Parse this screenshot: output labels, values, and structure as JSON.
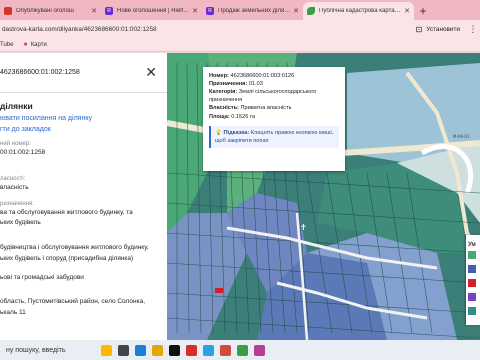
{
  "browser": {
    "tabs": [
      {
        "title": "Опублікувані оголош",
        "icon": "red"
      },
      {
        "title": "Нове оголошення | Rieltor від",
        "icon": "purple"
      },
      {
        "title": "Продаж земельних ділянок",
        "icon": "purple"
      },
      {
        "title": "Публічна кадастрова карта Ук",
        "icon": "leaf"
      }
    ],
    "new_tab_label": "+",
    "url": "dastrova-karta.com/dilyanka/4623686600:01:002:1258",
    "install_label": "Установити",
    "bookmarks": [
      {
        "label": "Tube"
      },
      {
        "label": "Карти"
      }
    ]
  },
  "panel": {
    "search_value": "4623686600:01:002:1258",
    "title": "ділянки",
    "share_link": "ювати посилання на ділянку",
    "bookmark_link": "гти до закладок",
    "cad_label": "ний номер:",
    "cad_value": "00:01:002:1258",
    "own_label": "ласності:",
    "own_value": "власність",
    "purpose_label": "ризначення:",
    "purpose_value_1": "ва та обслуговування житлового будинку, та",
    "purpose_value_2": "ьких будівель",
    "use_label": "",
    "use_value_1": "будівництва і обслуговування житлового будинку,",
    "use_value_2": "ьких будівель і споруд (присадибна ділянка)",
    "category_value": "ьові та громадські забудови",
    "address_value_1": "область, Пустомитівський район, село Солонка,",
    "address_value_2": "ькаль 11"
  },
  "popup": {
    "number_label": "Номер:",
    "number_value": "4623686600:01:003:0126",
    "purpose_label": "Призначення:",
    "purpose_value": "01.03",
    "category_label": "Категорія:",
    "category_value": "Землі сільськогосподарського призначення",
    "own_label": "Власність:",
    "own_value": "Приватна власність",
    "area_label": "Площа:",
    "area_value": "0.1526 га",
    "hint_label": "Підказка:",
    "hint_text": "Клацніть правою кнопкою миші, щоб закріпити попап"
  },
  "map": {
    "road_label": "M-06-01",
    "legend_label": "Ум"
  },
  "taskbar": {
    "search_text": "ну пошуку, введіть"
  }
}
